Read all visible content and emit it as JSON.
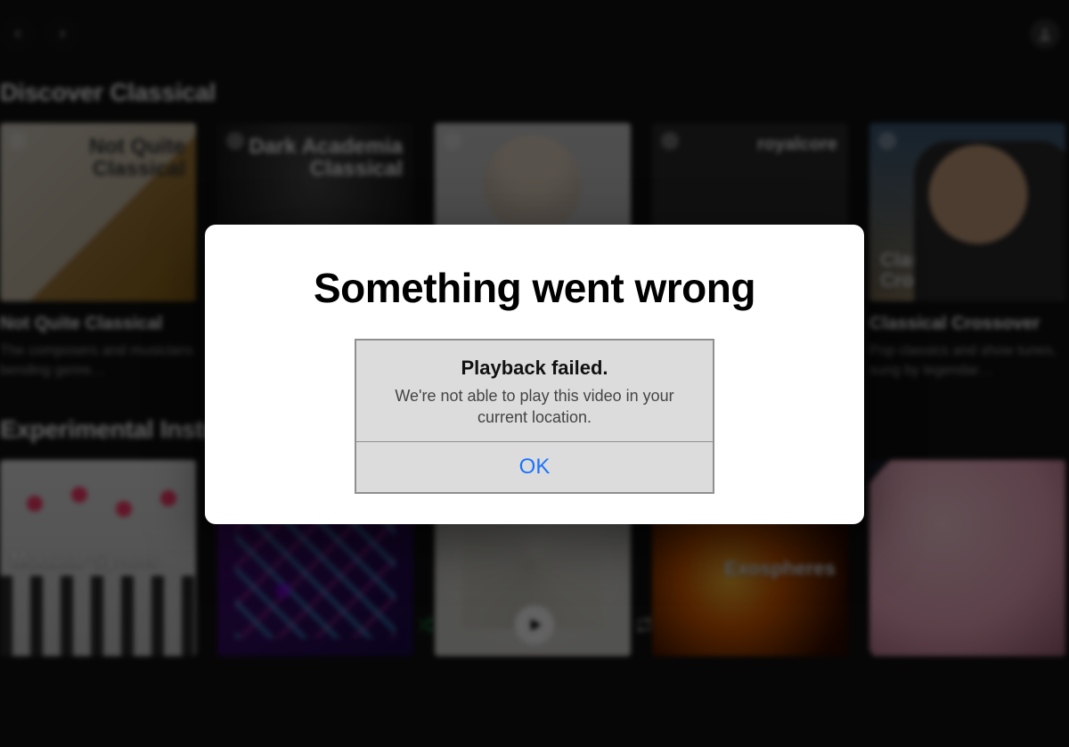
{
  "sections": {
    "discover": {
      "title": "Discover Classical",
      "cards": [
        {
          "cover_label": "Not Quite Classical",
          "title": "Not Quite Classical",
          "desc": "The composers and musicians bending genre…"
        },
        {
          "cover_label": "Dark Academia Classical",
          "title": "",
          "desc": ""
        },
        {
          "cover_label": "",
          "title": "",
          "desc": ""
        },
        {
          "cover_label": "royalcore",
          "title": "",
          "desc": ""
        },
        {
          "cover_label": "Classical Crossover",
          "title": "Classical Crossover",
          "desc": "Pop classics and show tunes, sung by legendar…"
        }
      ]
    },
    "experimental": {
      "title": "Experimental Instrume",
      "cards": [
        {
          "cover_label": "Modular Synths"
        },
        {
          "cover_label": ""
        },
        {
          "cover_label": ""
        },
        {
          "cover_label": "Exospheres"
        },
        {
          "cover_label": ""
        }
      ]
    }
  },
  "modal": {
    "heading": "Something went wrong",
    "alert_title": "Playback failed.",
    "alert_message": "We're not able to play this video in your current location.",
    "ok_label": "OK"
  },
  "icons": {
    "back": "chevron-left",
    "forward": "chevron-right",
    "profile": "user",
    "shuffle": "shuffle",
    "prev": "skip-back",
    "play": "play",
    "next": "skip-forward",
    "repeat": "repeat"
  }
}
